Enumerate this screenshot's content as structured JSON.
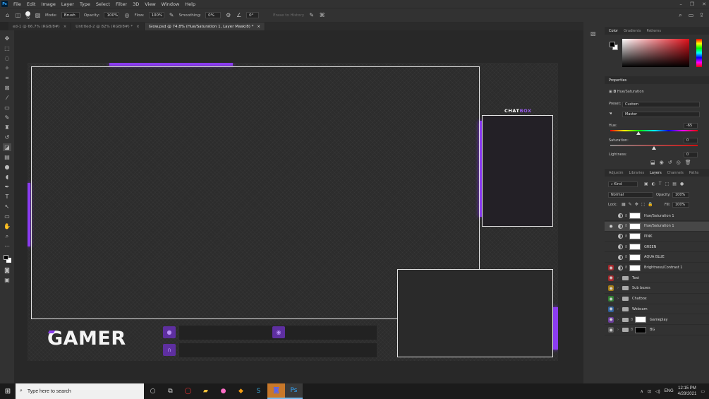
{
  "menubar": {
    "logo": "Ps",
    "items": [
      "File",
      "Edit",
      "Image",
      "Layer",
      "Type",
      "Select",
      "Filter",
      "3D",
      "View",
      "Window",
      "Help"
    ]
  },
  "options": {
    "brush_size": "72",
    "mode_label": "Mode:",
    "mode_value": "Brush",
    "opacity_label": "Opacity:",
    "opacity_value": "100%",
    "flow_label": "Flow:",
    "flow_value": "100%",
    "smoothing_label": "Smoothing:",
    "smoothing_value": "0%",
    "angle_value": "0°",
    "erase_history": "Erase to History"
  },
  "tabs": [
    {
      "label": "ed-1 @ 66.7% (RGB/8#)"
    },
    {
      "label": "Untitled-2 @ 82% (RGB/8#) *"
    },
    {
      "label": "Glow.psd @ 74.8% (Hue/Saturation 1, Layer Mask/8) *"
    }
  ],
  "overlay": {
    "chatbox_main": "CHAT",
    "chatbox_accent": "BOX",
    "logo_text": "GAMER",
    "accent_color": "#8b3cf0"
  },
  "color_panel": {
    "tabs": [
      "Color",
      "Gradients",
      "Patterns"
    ]
  },
  "properties": {
    "title": "Properties",
    "adjustment": "Hue/Saturation",
    "preset_label": "Preset:",
    "preset_value": "Custom",
    "channel_value": "Master",
    "hue_label": "Hue:",
    "hue_value": "-65",
    "hue_fraction": 0.32,
    "saturation_label": "Saturation:",
    "saturation_value": "0",
    "saturation_fraction": 0.5,
    "lightness_label": "Lightness:",
    "lightness_value": "0"
  },
  "layers_panel": {
    "tabs": [
      "Adjustm",
      "Libraries",
      "Layers",
      "Channels",
      "Paths"
    ],
    "kind_label": "Kind",
    "blend_mode": "Normal",
    "opacity_label": "Opacity:",
    "opacity_value": "100%",
    "lock_label": "Lock:",
    "fill_label": "Fill:",
    "fill_value": "100%",
    "layers": [
      {
        "name": "Hue/Saturation 1",
        "type": "adjustment",
        "visible": false,
        "eye_color": ""
      },
      {
        "name": "Hue/Saturation 1",
        "type": "adjustment",
        "visible": true,
        "eye_color": "",
        "selected": true
      },
      {
        "name": "PINK",
        "type": "adjustment",
        "visible": false,
        "eye_color": ""
      },
      {
        "name": "GREEN",
        "type": "adjustment",
        "visible": false,
        "eye_color": ""
      },
      {
        "name": "AQUA BLUE",
        "type": "adjustment",
        "visible": false,
        "eye_color": ""
      },
      {
        "name": "Brightness/Contrast 1",
        "type": "adjustment",
        "visible": true,
        "eye_color": "#a3282c"
      },
      {
        "name": "Text",
        "type": "group",
        "visible": true,
        "eye_color": "#a3282c"
      },
      {
        "name": "Sub boxes",
        "type": "group",
        "visible": true,
        "eye_color": "#a37b14"
      },
      {
        "name": "Chatbox",
        "type": "group",
        "visible": true,
        "eye_color": "#2f7d32"
      },
      {
        "name": "Webcam",
        "type": "group",
        "visible": true,
        "eye_color": "#2f5f9a"
      },
      {
        "name": "Gameplay",
        "type": "group_thumb",
        "visible": true,
        "eye_color": "#6a3c9a"
      },
      {
        "name": "BG",
        "type": "group_thumb_dark",
        "visible": true,
        "eye_color": "#5a5a5a"
      }
    ]
  },
  "taskbar": {
    "search_placeholder": "Type here to search",
    "lang": "ENG",
    "time": "12:15 PM",
    "date": "4/28/2021"
  }
}
